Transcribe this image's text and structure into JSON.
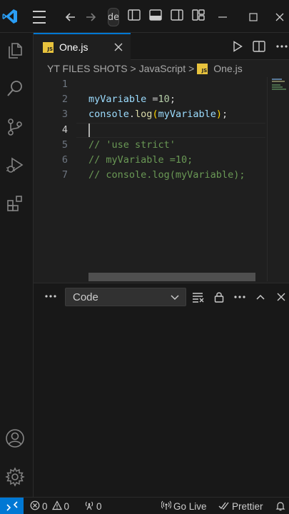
{
  "titlebar": {
    "command_center_text": "de",
    "icons": [
      "vscode-logo-icon",
      "menu-icon",
      "arrow-left-icon",
      "arrow-right-icon",
      "toggle-sidebar-icon",
      "toggle-panel-icon",
      "toggle-secondary-sidebar-icon",
      "customize-layout-icon",
      "minimize-icon",
      "maximize-icon",
      "close-icon"
    ]
  },
  "activitybar": {
    "items": [
      "explorer-icon",
      "search-icon",
      "source-control-icon",
      "run-debug-icon",
      "extensions-icon"
    ],
    "bottom": [
      "accounts-icon",
      "settings-gear-icon"
    ]
  },
  "tab": {
    "label": "One.js",
    "badge": "JS"
  },
  "breadcrumb": {
    "items": [
      "YT FILES SHOTS",
      "JavaScript",
      "One.js"
    ],
    "separator": ">"
  },
  "editor": {
    "line_numbers": [
      "1",
      "2",
      "3",
      "4",
      "5",
      "6",
      "7"
    ],
    "active_line": "4",
    "lines": {
      "l2": {
        "var": "myVariable",
        "op": " =",
        "num": "10",
        "semi": ";"
      },
      "l3": {
        "obj": "console",
        "dot": ".",
        "fn": "log",
        "open": "(",
        "arg": "myVariable",
        "close": ")",
        "semi": ";"
      },
      "l5": "// 'use strict'",
      "l6": "// myVariable =10;",
      "l7": "// console.log(myVariable);"
    }
  },
  "panel": {
    "selected_output": "Code"
  },
  "statusbar": {
    "errors": "0",
    "warnings": "0",
    "ports": "0",
    "go_live": "Go Live",
    "prettier": "Prettier"
  },
  "colors": {
    "accent": "#0078d4",
    "js_badge": "#e8c33d",
    "comment": "#6a9955",
    "variable": "#9cdcfe",
    "function": "#dcdcaa",
    "number": "#b5cea8"
  }
}
